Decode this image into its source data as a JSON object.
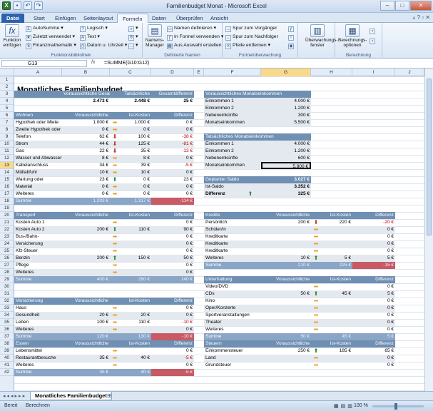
{
  "window": {
    "title": "Familienbudget Monat - Microsoft Excel"
  },
  "tabs": {
    "file": "Datei",
    "items": [
      "Start",
      "Einfügen",
      "Seitenlayout",
      "Formeln",
      "Daten",
      "Überprüfen",
      "Ansicht"
    ],
    "active": "Formeln"
  },
  "ribbon": {
    "insert_function": "Funktion einfügen",
    "autosum": "AutoSumme",
    "recent": "Zuletzt verwendet",
    "financial": "Finanzmathematik",
    "logical": "Logisch",
    "text": "Text",
    "datetime": "Datum u. Uhrzeit",
    "lib_label": "Funktionsbibliothek",
    "name_manager": "Namens-Manager",
    "define_name": "Namen definieren",
    "use_in_formula": "In Formel verwenden",
    "create_from_sel": "Aus Auswahl erstellen",
    "names_label": "Definierte Namen",
    "trace_precedents": "Spur zum Vorgänger",
    "trace_dependents": "Spur zum Nachfolger",
    "remove_arrows": "Pfeile entfernen",
    "audit_label": "Formelüberwachung",
    "watch_window": "Überwachungs-fenster",
    "calc_options": "Berechnungs-optionen",
    "calc_label": "Berechnung"
  },
  "formula_bar": {
    "namebox": "G13",
    "fx": "fx",
    "formula": "=SUMME(G10:G12)"
  },
  "columns": [
    "A",
    "B",
    "C",
    "D",
    "E",
    "F",
    "G",
    "H",
    "I",
    "J"
  ],
  "selected_column": "G",
  "selected_row": "13",
  "rows": [
    "1",
    "2",
    "3",
    "4",
    "5",
    "6",
    "7",
    "8",
    "9",
    "10",
    "11",
    "12",
    "13",
    "14",
    "15",
    "16",
    "17",
    "18",
    "19",
    "20",
    "21",
    "22",
    "23",
    "24",
    "25",
    "26",
    "27",
    "28",
    "29",
    "30",
    "31",
    "32",
    "33",
    "34",
    "35",
    "36",
    "37",
    "38",
    "39",
    "40",
    "41",
    "42"
  ],
  "sheet": {
    "title": "Monatliches Familienbudget",
    "summary_headers": [
      "Voraussichtliche Gesamtkosten",
      "Tatsächliche",
      "Gesamtdifferenz"
    ],
    "summary_values": [
      "2.473 €",
      "2.448 €",
      "25 €"
    ],
    "col_headers": [
      "Voraussichtliche",
      "Ist-Kosten",
      "Differenz"
    ],
    "col_headers_right": [
      "Voraussichtliche",
      "Ist-Kosten",
      "Differenz"
    ],
    "wohnen": {
      "title": "Wohnen",
      "summe": "Summe",
      "sum_values": [
        "1.203 €",
        "1.317 €",
        "-114 €"
      ],
      "rows": [
        [
          "Hypothek oder Miete",
          "1.000 €",
          "1.000 €",
          "0 €"
        ],
        [
          "Zweite Hypothek oder",
          "0 €",
          "0 €",
          "0 €"
        ],
        [
          "Telefon",
          "62 €",
          "100 €",
          "-38 €"
        ],
        [
          "Strom",
          "44 €",
          "125 €",
          "-81 €"
        ],
        [
          "Gas",
          "22 €",
          "35 €",
          "-13 €"
        ],
        [
          "Wasser und Abwasser",
          "8 €",
          "8 €",
          "0 €"
        ],
        [
          "Kabelanschluss",
          "34 €",
          "39 €",
          "-5 €"
        ],
        [
          "Müllabfuhr",
          "10 €",
          "10 €",
          "0 €"
        ],
        [
          "Wartung oder",
          "23 €",
          "0 €",
          "23 €"
        ],
        [
          "Material",
          "0 €",
          "0 €",
          "0 €"
        ],
        [
          "Weiteres",
          "0 €",
          "0 €",
          "0 €"
        ]
      ]
    },
    "transport": {
      "title": "Transport",
      "summe": "Summe",
      "sum_values": [
        "400 €",
        "260 €",
        "140 €"
      ],
      "rows": [
        [
          "Kosten Auto 1",
          "",
          "",
          "0 €"
        ],
        [
          "Kosten Auto 2",
          "200 €",
          "110 €",
          "90 €"
        ],
        [
          "Bus-/Bahn-",
          "",
          "",
          "0 €"
        ],
        [
          "Versicherung",
          "",
          "",
          "0 €"
        ],
        [
          "Kfz-Steuer",
          "",
          "",
          "0 €"
        ],
        [
          "Benzin",
          "200 €",
          "150 €",
          "50 €"
        ],
        [
          "Pflege",
          "",
          "",
          "0 €"
        ],
        [
          "Weiteres",
          "",
          "",
          "0 €"
        ]
      ]
    },
    "versicherung": {
      "title": "Versicherung",
      "summe": "Summe",
      "sum_values": [
        "120 €",
        "130 €",
        "-10 €"
      ],
      "rows": [
        [
          "Haus",
          "",
          "",
          "0 €"
        ],
        [
          "Gesundheit",
          "20 €",
          "20 €",
          "0 €"
        ],
        [
          "Leben",
          "100 €",
          "110 €",
          "-10 €"
        ],
        [
          "Weiteres",
          "",
          "",
          "0 €"
        ]
      ]
    },
    "essen": {
      "title": "Essen",
      "summe": "Summe",
      "sum_values": [
        "35 €",
        "40 €",
        "-5 €"
      ],
      "rows": [
        [
          "Lebensmittel",
          "",
          "",
          "0 €"
        ],
        [
          "Restaurantbesuche",
          "35 €",
          "40 €",
          "-5 €"
        ],
        [
          "Weiteres",
          "",
          "",
          "0 €"
        ]
      ]
    },
    "einkommen_vor": {
      "title": "Voraussichtliches Monatseinkommen",
      "rows": [
        [
          "Einkommen 1",
          "4.000 €"
        ],
        [
          "Einkommen 2",
          "1.200 €"
        ],
        [
          "Nebeneinkünfte",
          "300 €"
        ],
        [
          "Monatseinkommen",
          "5.500 €"
        ]
      ]
    },
    "einkommen_tat": {
      "title": "Tatsächliches Monatseinkommen",
      "rows": [
        [
          "Einkommen 1",
          "4.000 €"
        ],
        [
          "Einkommen 2",
          "1.200 €"
        ],
        [
          "Nebeneinkünfte",
          "600 €"
        ],
        [
          "Monatseinkommen",
          "5.800 €"
        ]
      ]
    },
    "saldo": {
      "rows": [
        [
          "Geplanter Saldo",
          "3.027 €"
        ],
        [
          "Ist-Saldo",
          "3.352 €"
        ],
        [
          "Differenz",
          "325 €"
        ]
      ]
    },
    "kredite": {
      "title": "Kredite",
      "summe": "Summe",
      "sum_values": [
        "210 €",
        "225 €",
        "-15 €"
      ],
      "rows": [
        [
          "Persönlich",
          "200 €",
          "220 €",
          "-20 €"
        ],
        [
          "Schüler/in",
          "",
          "",
          "0 €"
        ],
        [
          "Kreditkarte",
          "",
          "",
          "0 €"
        ],
        [
          "Kreditkarte",
          "",
          "",
          "0 €"
        ],
        [
          "Kreditkarte",
          "",
          "",
          "0 €"
        ],
        [
          "Weiteres",
          "10 €",
          "5 €",
          "5 €"
        ]
      ]
    },
    "unterhaltung": {
      "title": "Unterhaltung",
      "summe": "Summe",
      "sum_values": [
        "50 €",
        "45 €",
        "5 €"
      ],
      "rows": [
        [
          "Video/DVD",
          "",
          "",
          "0 €"
        ],
        [
          "CDs",
          "50 €",
          "45 €",
          "5 €"
        ],
        [
          "Kino",
          "",
          "",
          "0 €"
        ],
        [
          "Oper/Konzerte",
          "",
          "",
          "0 €"
        ],
        [
          "Sportveranstaltungen",
          "",
          "",
          "0 €"
        ],
        [
          "Theater",
          "",
          "",
          "0 €"
        ],
        [
          "Weiteres",
          "",
          "",
          "0 €"
        ]
      ]
    },
    "steuern": {
      "title": "Steuern",
      "rows": [
        [
          "Einkommensteuer",
          "250 €",
          "185 €",
          "65 €"
        ],
        [
          "Land",
          "",
          "",
          "0 €"
        ],
        [
          "Grundsteuer",
          "",
          "",
          "0 €"
        ]
      ]
    }
  },
  "sheet_tab": "Monatliches Familienbudget",
  "status": {
    "ready": "Bereit",
    "calc": "Berechnen",
    "zoom": "100 %"
  }
}
